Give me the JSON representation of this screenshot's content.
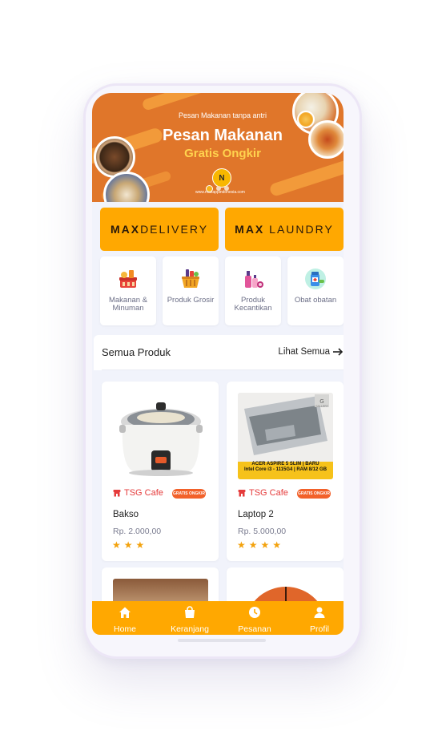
{
  "banner": {
    "subtitle": "Pesan Makanan tanpa antri",
    "title": "Pesan Makanan",
    "title2": "Gratis Ongkir",
    "logo_text": "N",
    "url": "www.maxappindonesia.com"
  },
  "services": [
    {
      "bold": "MAX",
      "rest": "DELIVERY"
    },
    {
      "bold": "MAX",
      "rest": " LAUNDRY"
    }
  ],
  "categories": [
    {
      "label": "Makanan & Minuman",
      "icon": "food-basket-icon"
    },
    {
      "label": "Produk Grosir",
      "icon": "grocery-basket-icon"
    },
    {
      "label": "Produk Kecantikan",
      "icon": "cosmetics-icon"
    },
    {
      "label": "Obat obatan",
      "icon": "medicine-icon"
    }
  ],
  "section": {
    "title": "Semua Produk",
    "link": "Lihat Semua"
  },
  "products": [
    {
      "shop": "TSG Cafe",
      "badge": "GRATIS ONGKIR",
      "name": "Bakso",
      "price": "Rp. 2.000,00",
      "rating": 3,
      "stars": "★★★"
    },
    {
      "shop": "TSG Cafe",
      "badge": "GRATIS ONGKIR",
      "name": "Laptop 2",
      "price": "Rp. 5.000,00",
      "rating": 4,
      "stars": "★★★★"
    }
  ],
  "laptop_caption": {
    "line1": "ACER ASPIRE 5 SLIM | BARU",
    "line2": "Intel Core i3 - 1115G4 | RAM 8/12 GB",
    "line3": "GALLERY"
  },
  "nav": [
    {
      "label": "Home",
      "icon": "home-icon"
    },
    {
      "label": "Keranjang",
      "icon": "bag-icon"
    },
    {
      "label": "Pesanan",
      "icon": "clock-icon"
    },
    {
      "label": "Profil",
      "icon": "user-icon"
    }
  ],
  "colors": {
    "accent": "#ffa801",
    "banner": "#e0762a",
    "shop_text": "#e53b3b",
    "star": "#f3a20d"
  }
}
